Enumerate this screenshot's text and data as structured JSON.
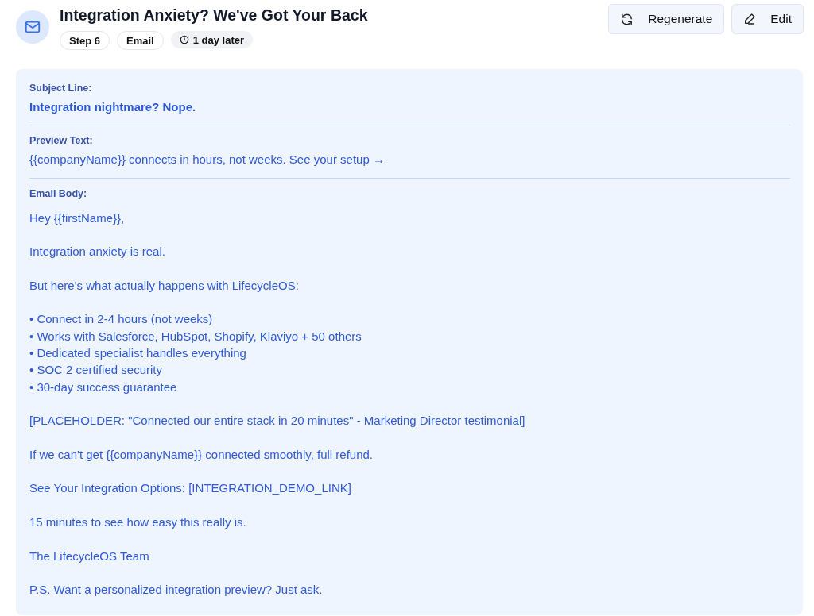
{
  "header": {
    "title": "Integration Anxiety? We've Got Your Back",
    "tags": [
      {
        "label": "Step 6",
        "kind": "outline"
      },
      {
        "label": "Email",
        "kind": "outline"
      },
      {
        "label": "1 day later",
        "kind": "time"
      }
    ]
  },
  "actions": [
    {
      "label": "Regenerate",
      "kind": "regenerate"
    },
    {
      "label": "Edit",
      "kind": "edit"
    }
  ],
  "subject": {
    "label": "Subject Line:",
    "value": "Integration nightmare? Nope."
  },
  "preview": {
    "label": "Preview Text:",
    "value": "{{companyName}} connects in hours, not weeks. See your setup →"
  },
  "body": {
    "label": "Email Body:",
    "paragraphs": [
      [
        "Hey {{firstName}},"
      ],
      [
        "Integration anxiety is real."
      ],
      [
        "But here's what actually happens with LifecycleOS:"
      ],
      [
        "• Connect in 2-4 hours (not weeks)",
        "• Works with Salesforce, HubSpot, Shopify, Klaviyo + 50 others",
        "• Dedicated specialist handles everything",
        "• SOC 2 certified security",
        "• 30-day success guarantee"
      ],
      [
        "[PLACEHOLDER: \"Connected our entire stack in 20 minutes\" - Marketing Director testimonial]"
      ],
      [
        "If we can't get {{companyName}} connected smoothly, full refund."
      ],
      [
        "See Your Integration Options: [INTEGRATION_DEMO_LINK]"
      ],
      [
        "15 minutes to see how easy this really is."
      ],
      [
        "The LifecycleOS Team"
      ],
      [
        "P.S. Want a personalized integration preview? Just ask."
      ]
    ]
  }
}
